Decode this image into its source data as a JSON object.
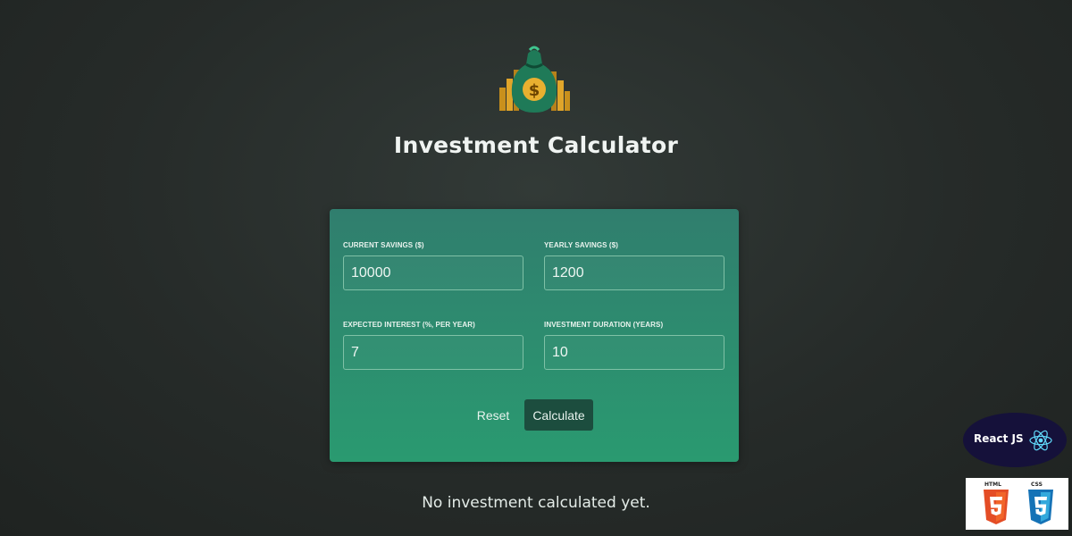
{
  "app": {
    "title": "Investment Calculator",
    "logo_icon": "money-bag-icon"
  },
  "form": {
    "fields": [
      {
        "label": "CURRENT SAVINGS ($)",
        "value": "10000"
      },
      {
        "label": "YEARLY SAVINGS ($)",
        "value": "1200"
      },
      {
        "label": "EXPECTED INTEREST (%, PER YEAR)",
        "value": "7"
      },
      {
        "label": "INVESTMENT DURATION (YEARS)",
        "value": "10"
      }
    ],
    "reset_label": "Reset",
    "calculate_label": "Calculate"
  },
  "status_text": "No investment calculated yet.",
  "badges": {
    "react_label": "React JS",
    "react_icon": "react-atom-icon",
    "html_label": "HTML",
    "css_label": "CSS",
    "html_icon": "html5-shield-icon",
    "css_icon": "css3-shield-icon"
  },
  "colors": {
    "background": "#262b29",
    "card_top": "#307e6e",
    "card_bottom": "#2a9a70",
    "calculate_button": "#1c4d3e"
  }
}
